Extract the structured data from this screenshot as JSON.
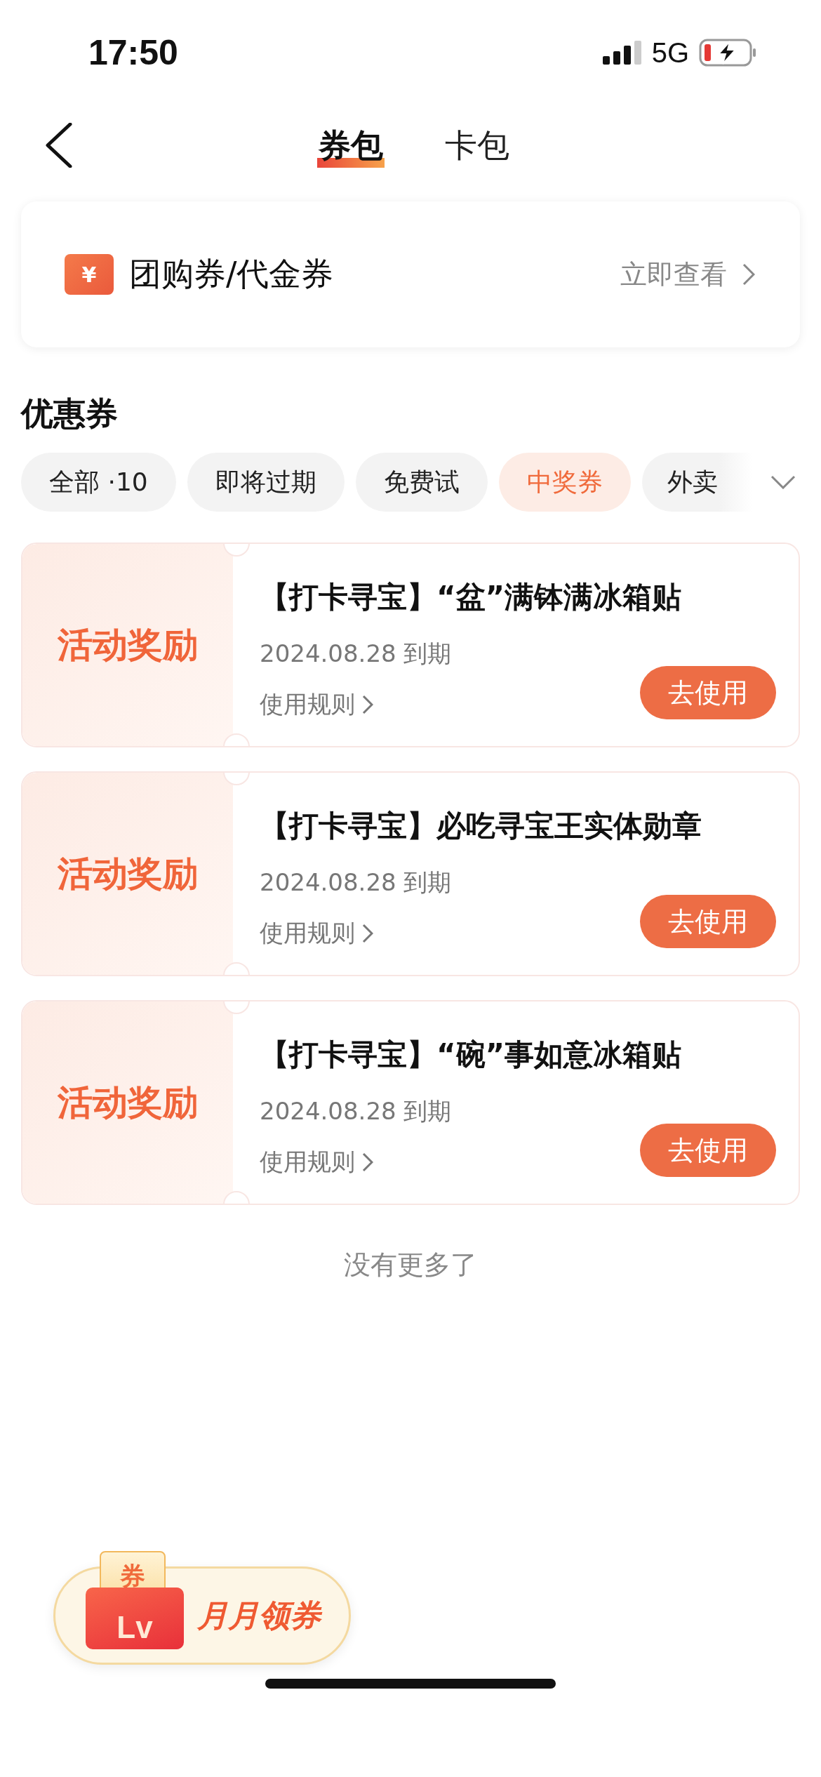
{
  "status_bar": {
    "time": "17:50",
    "network": "5G"
  },
  "nav": {
    "tabs": [
      {
        "label": "券包",
        "selected": true
      },
      {
        "label": "卡包",
        "selected": false
      }
    ]
  },
  "group_buy": {
    "title": "团购券/代金券",
    "icon_text": "¥",
    "link": "立即查看"
  },
  "section_title": "优惠券",
  "filters": [
    {
      "label": "全部 ·10",
      "selected": false
    },
    {
      "label": "即将过期",
      "selected": false
    },
    {
      "label": "免费试",
      "selected": false
    },
    {
      "label": "中奖券",
      "selected": true
    },
    {
      "label": "外卖",
      "selected": false
    }
  ],
  "coupons": [
    {
      "tag": "活动奖励",
      "title": "【打卡寻宝】“盆”满钵满冰箱贴",
      "expiry": "2024.08.28 到期",
      "rules": "使用规则",
      "button": "去使用"
    },
    {
      "tag": "活动奖励",
      "title": "【打卡寻宝】必吃寻宝王实体勋章",
      "expiry": "2024.08.28 到期",
      "rules": "使用规则",
      "button": "去使用"
    },
    {
      "tag": "活动奖励",
      "title": "【打卡寻宝】“碗”事如意冰箱贴",
      "expiry": "2024.08.28 到期",
      "rules": "使用规则",
      "button": "去使用"
    }
  ],
  "end_note": "没有更多了",
  "floating_badge": {
    "ticket_text": "券",
    "envelope_text": "Lv",
    "label": "月月领券"
  }
}
